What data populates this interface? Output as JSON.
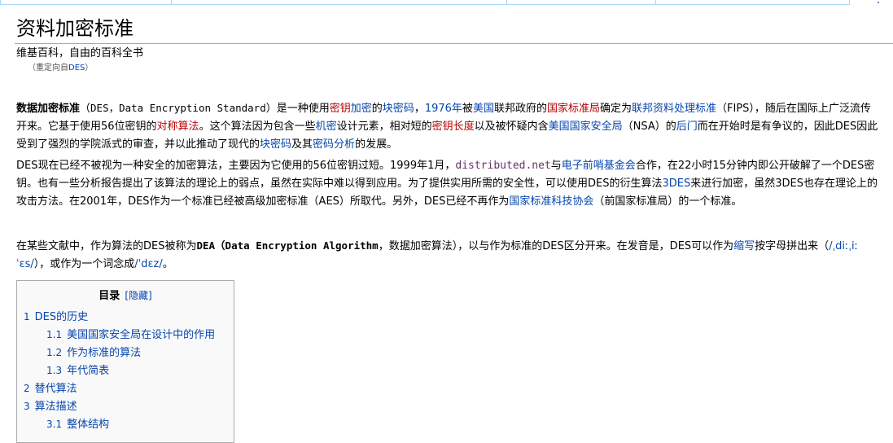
{
  "heading": "资料加密标准",
  "site_sub": "维基百科，自由的百科全书",
  "redirect": {
    "pre": "（重定向自",
    "link": "DES",
    "post": "）"
  },
  "para1": {
    "s1": "数据加密标准",
    "s2": "（",
    "s3": "DES，Data Encryption Standard",
    "s4": "）是一种使用",
    "s5": "密钥",
    "s6": "加密",
    "s7": "的",
    "s8": "块密码",
    "s9": "，",
    "s10": "1976年",
    "s11": "被",
    "s12": "美国",
    "s13": "联邦政府的",
    "s14": "国家标准局",
    "s15": "确定为",
    "s16": "联邦资料处理标准",
    "s17": "（FIPS），随后在国际上广泛流传开来。它基于使用56位密钥的",
    "s18": "对称算法",
    "s19": "。这个算法因为包含一些",
    "s20": "机密",
    "s21": "设计元素，相对短的",
    "s22": "密钥长度",
    "s23": "以及被怀疑内含",
    "s24": "美国国家安全局",
    "s25": "（NSA）的",
    "s26": "后门",
    "s27": "而在开始时是有争议的，因此DES因此受到了强烈的学院派式的审查，并以此推动了现代的",
    "s28": "块密码",
    "s29": "及其",
    "s30": "密码分析",
    "s31": "的发展。"
  },
  "para2": {
    "s1": "DES现在已经不被视为一种安全的加密算法，主要因为它使用的56位密钥过短。1999年1月，",
    "s2": "distributed.net",
    "s3": "与",
    "s4": "电子前哨基金会",
    "s5": "合作，在22小时15分钟内即公开破解了一个DES密钥。也有一些分析报告提出了该算法的理论上的弱点，虽然在实际中难以得到应用。为了提供实用所需的安全性，可以使用DES的衍生算法",
    "s6": "3DES",
    "s7": "来进行加密，虽然3DES也存在理论上的攻击方法。在2001年，DES作为一个标准已经被高级加密标准（AES）所取代。另外，DES已经不再作为",
    "s8": "国家标准科技协会",
    "s9": "（前国家标准局）的一个标准。"
  },
  "para3": {
    "s1": "在某些文献中，作为算法的DES被称为",
    "s2": "DEA（Data Encryption Algorithm",
    "s3": "，数据加密算法），以与作为标准的DES区分开来。在发音是，DES可以作为",
    "s4": "缩写",
    "s5": "按字母拼出来（",
    "s6": "/ˌdiːˌiːˈɛs/",
    "s7": "），或作为一个词念成",
    "s8": "/ˈdɛz/",
    "s9": "。"
  },
  "toc": {
    "title": "目录",
    "toggle": "[隐藏]",
    "items": [
      {
        "num": "1",
        "text": "DES的历史"
      },
      {
        "num": "1.1",
        "text": "美国国家安全局在设计中的作用"
      },
      {
        "num": "1.2",
        "text": "作为标准的算法"
      },
      {
        "num": "1.3",
        "text": "年代简表"
      },
      {
        "num": "2",
        "text": "替代算法"
      },
      {
        "num": "3",
        "text": "算法描述"
      },
      {
        "num": "3.1",
        "text": "整体结构"
      }
    ]
  },
  "colors": {
    "link": "#0645ad",
    "redlink": "#ba0000",
    "external": "#663366",
    "rule": "#aaaaaa",
    "toc_bg": "#f9f9f9"
  }
}
